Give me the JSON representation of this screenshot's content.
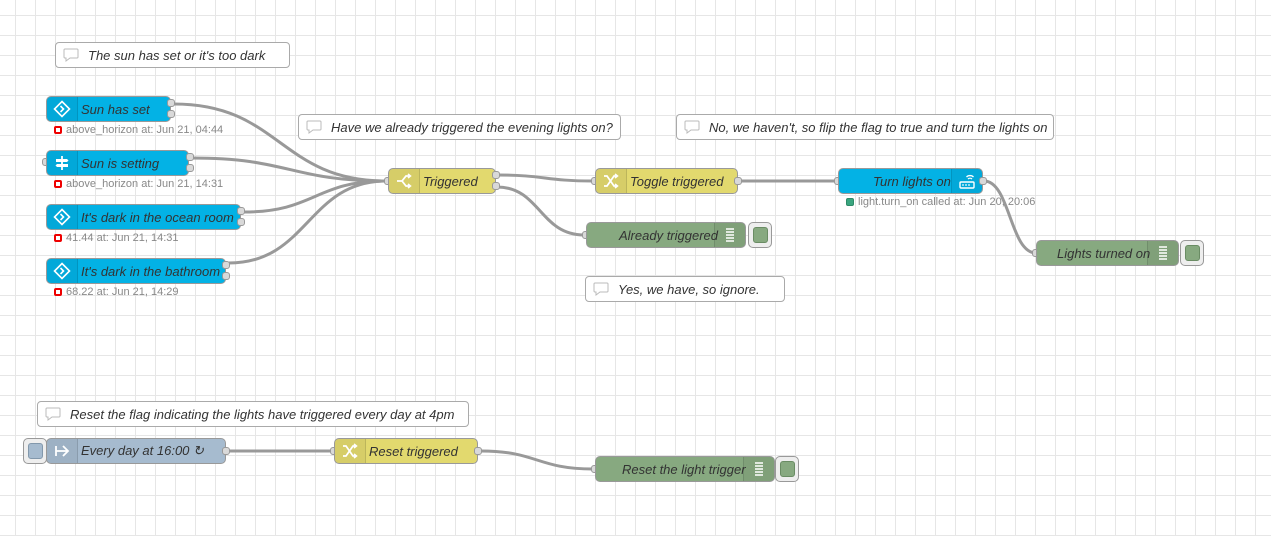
{
  "comments": {
    "sun_set": "The sun has set or it's too dark",
    "already_triggered": "Have we already triggered the evening lights on?",
    "not_triggered": "No, we haven't, so flip the flag to true and turn the lights on",
    "yes_ignore": "Yes, we have, so ignore.",
    "reset_flag": "Reset the flag indicating the lights have triggered every day at 4pm"
  },
  "nodes": {
    "sun_has_set": {
      "label": "Sun has set",
      "status": "above_horizon at: Jun 21, 04:44",
      "icon": "ha-state-icon"
    },
    "sun_is_setting": {
      "label": "Sun is setting",
      "status": "above_horizon at: Jun 21, 14:31",
      "icon": "signpost-icon"
    },
    "dark_ocean_room": {
      "label": "It's dark in the ocean room",
      "status": "41.44 at: Jun 21, 14:31",
      "icon": "ha-state-icon"
    },
    "dark_bathroom": {
      "label": "It's dark in the bathroom",
      "status": "68.22 at: Jun 21, 14:29",
      "icon": "ha-state-icon"
    },
    "triggered": {
      "label": "Triggered",
      "icon": "switch-icon"
    },
    "toggle_triggered": {
      "label": "Toggle triggered",
      "icon": "shuffle-icon"
    },
    "already_triggered": {
      "label": "Already triggered",
      "icon": "debug-list-icon"
    },
    "turn_lights_on": {
      "label": "Turn lights on",
      "status": "light.turn_on called at: Jun 20, 20:06",
      "icon": "ha-service-icon"
    },
    "lights_turned_on": {
      "label": "Lights turned on",
      "icon": "debug-list-icon"
    },
    "every_day": {
      "label": "Every day at 16:00 ↻",
      "icon": "inject-arrow-icon"
    },
    "reset_triggered": {
      "label": "Reset triggered",
      "icon": "shuffle-icon"
    },
    "reset_light_trigger": {
      "label": "Reset the light trigger",
      "icon": "debug-list-icon"
    }
  },
  "colors": {
    "home_assistant": "#03b2e5",
    "switch_change": "#e2d96e",
    "debug": "#87a980",
    "inject": "#a6bbcf",
    "wire": "#999999",
    "status_error": "#ee0000",
    "status_ok": "#3aa57f"
  }
}
